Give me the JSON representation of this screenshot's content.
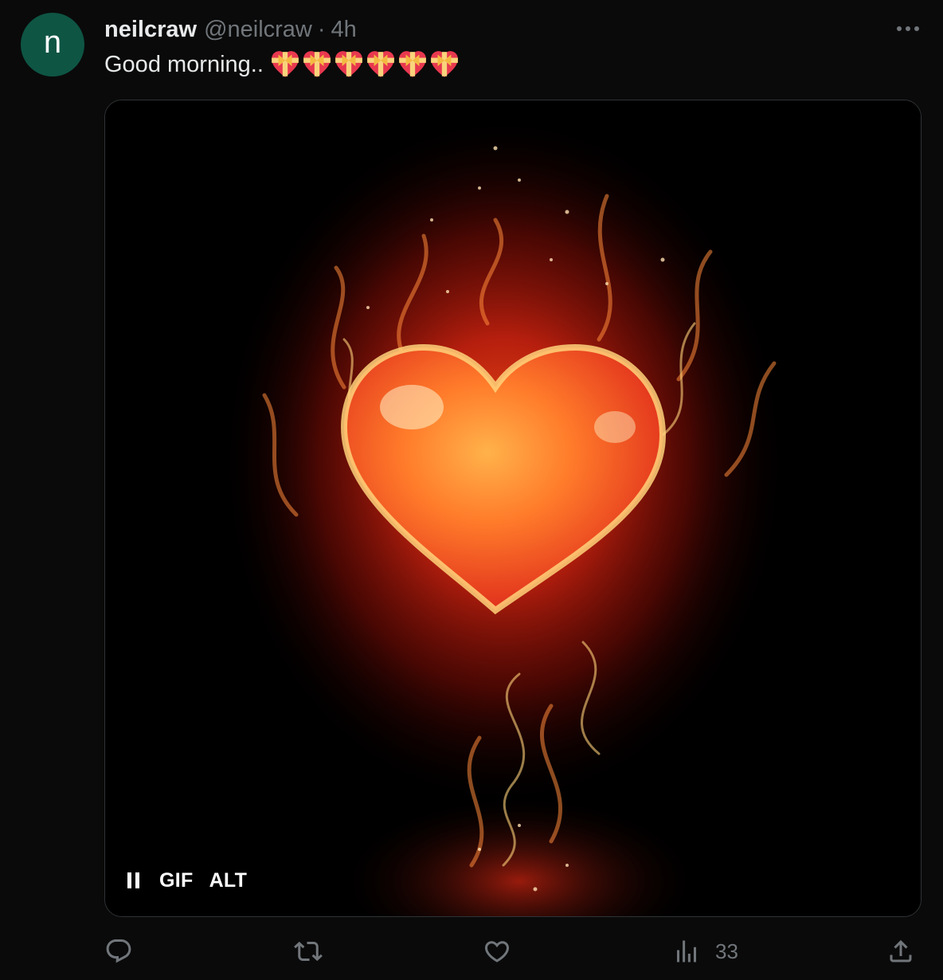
{
  "tweet": {
    "avatar_letter": "n",
    "display_name": "neilcraw",
    "handle": "@neilcraw",
    "separator": "·",
    "timestamp": "4h",
    "text": "Good morning..",
    "emojis": [
      "heart-with-ribbon",
      "heart-with-ribbon",
      "heart-with-ribbon",
      "heart-with-ribbon",
      "heart-with-ribbon",
      "heart-with-ribbon"
    ]
  },
  "media": {
    "type_badge": "GIF",
    "alt_label": "ALT",
    "playing": true
  },
  "actions": {
    "reply_icon": "reply-icon",
    "retweet_icon": "retweet-icon",
    "like_icon": "heart-icon",
    "views_icon": "views-icon",
    "views_count": "33",
    "share_icon": "share-icon"
  },
  "colors": {
    "background": "#0a0a0a",
    "avatar_bg": "#0e5544",
    "secondary_text": "#71767b",
    "primary_text": "#e7e9ea",
    "border": "#2f3336"
  }
}
